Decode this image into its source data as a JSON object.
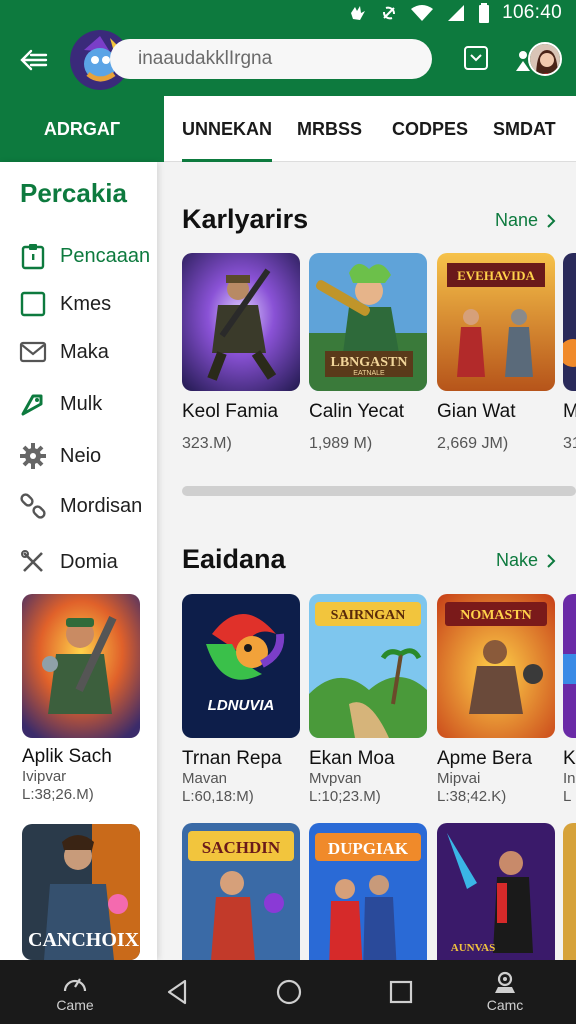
{
  "status_bar": {
    "time": "106:40"
  },
  "search": {
    "placeholder": "inaaudakklIrgna"
  },
  "tabs": [
    {
      "label": "ADRGAГ"
    },
    {
      "label": "UNNEKAN"
    },
    {
      "label": "MRBSS"
    },
    {
      "label": "CODPES"
    },
    {
      "label": "SMDAT"
    }
  ],
  "sidebar": {
    "title": "Percakia",
    "items": [
      {
        "label": "Pencaaan",
        "icon": "clipboard-icon"
      },
      {
        "label": "Kmes",
        "icon": "square-icon"
      },
      {
        "label": "Maka",
        "icon": "mail-icon"
      },
      {
        "label": "Mulk",
        "icon": "tag-icon"
      },
      {
        "label": "Neio",
        "icon": "gear-icon"
      },
      {
        "label": "Mordisan",
        "icon": "link-icon"
      },
      {
        "label": "Domia",
        "icon": "tools-icon"
      }
    ],
    "cards": [
      {
        "name": "Aplik Sach",
        "sub1": "Ivipvar",
        "sub2": "L:38;26.M)"
      },
      {
        "name": "",
        "art_text": "CANCHOIX"
      }
    ]
  },
  "sections": [
    {
      "title": "Karlyarirs",
      "more": "Nane",
      "cards": [
        {
          "name": "Keol Famia",
          "size": "323.M)"
        },
        {
          "name": "Calin Yecat",
          "size": "1,989 M)",
          "art_text": "LBNGASTN",
          "art_sub": "EATNALE"
        },
        {
          "name": "Gian Wat",
          "size": "2,669 JM)",
          "art_text": "EVEHAVIDA"
        },
        {
          "name": "M",
          "size": "31"
        }
      ]
    },
    {
      "title": "Eaidana",
      "more": "Nake",
      "cards": [
        {
          "name": "Trnan Repa",
          "sub1": "Mavan",
          "sub2": "L:60,18:M)",
          "art_text": "LDNUVIA"
        },
        {
          "name": "Ekan Moa",
          "sub1": "Mvpvan",
          "sub2": "L:10;23.M)",
          "art_text": "SAIRNGAN"
        },
        {
          "name": "Apme Bera",
          "sub1": "Mipvai",
          "sub2": "L:38;42.K)",
          "art_text": "NOMASTN"
        },
        {
          "name": "K",
          "sub1": "In",
          "sub2": "L"
        }
      ]
    },
    {
      "cards": [
        {
          "art_text": "SACHDIN"
        },
        {
          "art_text": "DUPGIAK"
        },
        {
          "art_text": "AUNVAS"
        }
      ]
    }
  ],
  "navbar": {
    "left_label": "Came",
    "right_label": "Camc"
  },
  "colors": {
    "primary": "#0d7a3e",
    "background": "#f3f3f3",
    "navbar": "#1a1a1a"
  }
}
